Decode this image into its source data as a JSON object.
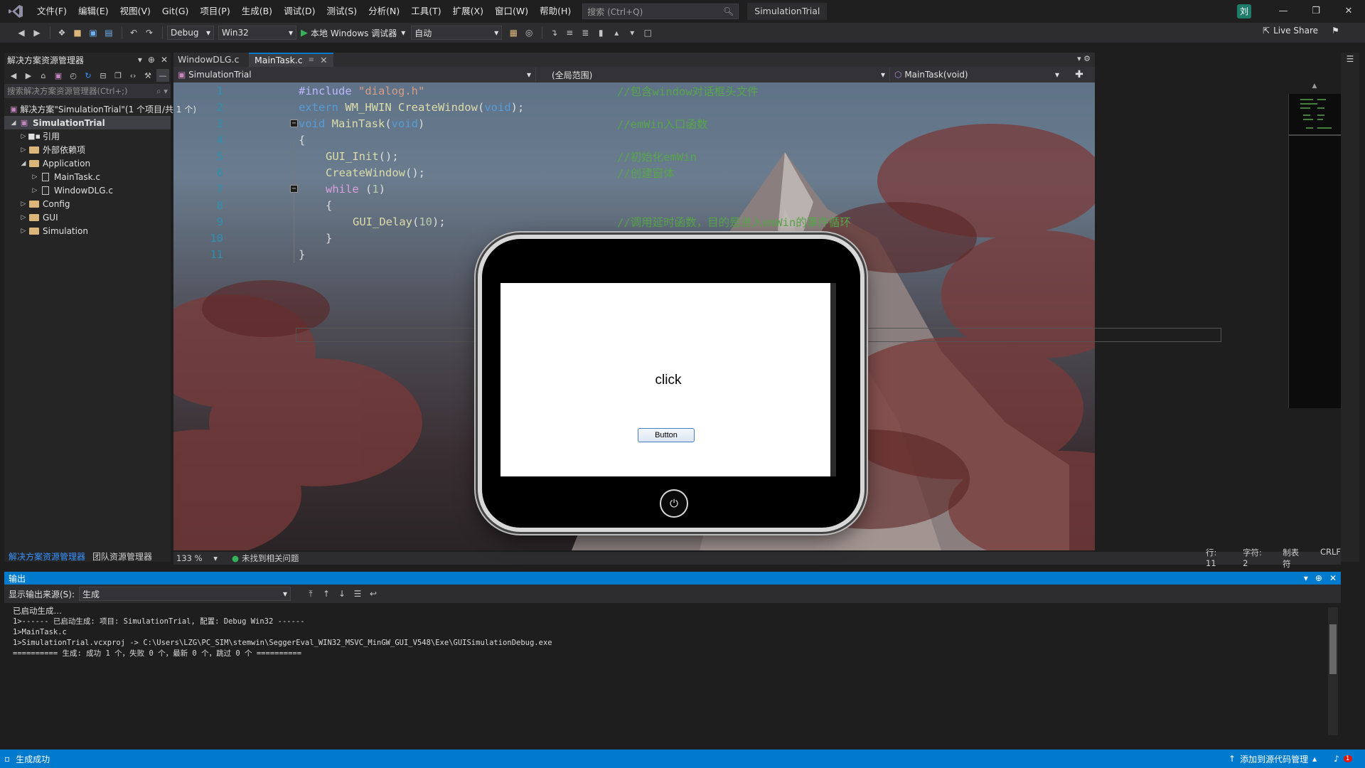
{
  "app": {
    "menu": [
      "文件(F)",
      "编辑(E)",
      "视图(V)",
      "Git(G)",
      "项目(P)",
      "生成(B)",
      "调试(D)",
      "测试(S)",
      "分析(N)",
      "工具(T)",
      "扩展(X)",
      "窗口(W)",
      "帮助(H)"
    ],
    "search_placeholder": "搜索 (Ctrl+Q)",
    "project_name": "SimulationTrial",
    "user_initial": "刘"
  },
  "toolbar": {
    "config": "Debug",
    "platform": "Win32",
    "run_label": "本地 Windows 调试器",
    "run_mode": "自动",
    "live_share": "Live Share"
  },
  "solution_explorer": {
    "title": "解决方案资源管理器",
    "search_placeholder": "搜索解决方案资源管理器(Ctrl+;)",
    "solution_label": "解决方案\"SimulationTrial\"(1 个项目/共 1 个)",
    "project": "SimulationTrial",
    "items": [
      {
        "label": "引用",
        "type": "ref"
      },
      {
        "label": "外部依赖项",
        "type": "dep"
      },
      {
        "label": "Application",
        "type": "folder"
      },
      {
        "label": "MainTask.c",
        "type": "file"
      },
      {
        "label": "WindowDLG.c",
        "type": "file"
      },
      {
        "label": "Config",
        "type": "folder"
      },
      {
        "label": "GUI",
        "type": "folder"
      },
      {
        "label": "Simulation",
        "type": "folder"
      }
    ],
    "tab_solution": "解决方案资源管理器",
    "tab_team": "团队资源管理器"
  },
  "editor": {
    "tabs": [
      "WindowDLG.c",
      "MainTask.c"
    ],
    "nav_project": "SimulationTrial",
    "nav_scope": "(全局范围)",
    "nav_member": "MainTask(void)",
    "line_numbers": [
      "1",
      "2",
      "3",
      "4",
      "5",
      "6",
      "7",
      "8",
      "9",
      "10",
      "11"
    ],
    "lines": {
      "l1_pp": "#include ",
      "l1_str": "\"dialog.h\"",
      "l1_comment": "//包含window对话框头文件",
      "l2_kw": "extern ",
      "l2_type": "WM_HWIN",
      "l2_fn": " CreateWindow",
      "l2_rest_a": "(",
      "l2_void": "void",
      "l2_rest_b": ");",
      "l3_kw": "void",
      "l3_fn": " MainTask",
      "l3_rest_a": "(",
      "l3_void": "void",
      "l3_rest_b": ")",
      "l3_comment": "//emWin入口函数",
      "l4": "{",
      "l5_fn": "GUI_Init",
      "l5_rest": "();",
      "l5_comment": "//初始化emWin",
      "l6_fn": "CreateWindow",
      "l6_rest": "();",
      "l6_comment": "//创建窗体",
      "l7_kw": "while",
      "l7_rest_a": " (",
      "l7_num": "1",
      "l7_rest_b": ")",
      "l8": "{",
      "l9_fn": "GUI_Delay",
      "l9_rest_a": "(",
      "l9_num": "10",
      "l9_rest_b": ");",
      "l9_comment": "//调用延时函数，目的是进入emWin的事件循环",
      "l10": "}",
      "l11": "}"
    },
    "zoom": "133 %",
    "issues": "未找到相关问题",
    "row": "行: 11",
    "col": "字符: 2",
    "tabs_mode": "制表符",
    "eol": "CRLF"
  },
  "simulator": {
    "label_text": "click",
    "button_text": "Button"
  },
  "output": {
    "title": "输出",
    "source_label": "显示输出来源(S):",
    "source_value": "生成",
    "lines": [
      "已启动生成…",
      "1>------ 已启动生成: 项目: SimulationTrial, 配置: Debug Win32 ------",
      "1>MainTask.c",
      "1>SimulationTrial.vcxproj -> C:\\Users\\LZG\\PC_SIM\\stemwin\\SeggerEval_WIN32_MSVC_MinGW_GUI_V548\\Exe\\GUISimulationDebug.exe",
      "========== 生成: 成功 1 个，失败 0 个，最新 0 个，跳过 0 个 =========="
    ]
  },
  "statusbar": {
    "left": "生成成功",
    "source_control": "添加到源代码管理",
    "notif_count": "1"
  }
}
